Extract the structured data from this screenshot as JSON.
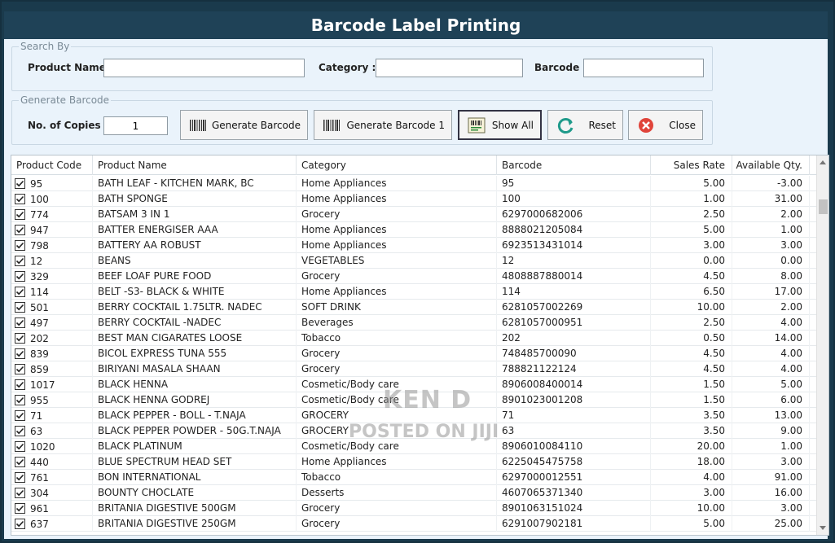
{
  "window": {
    "title": "Barcode Label Printing"
  },
  "search": {
    "legend": "Search By",
    "product_name_label": "Product Name :",
    "product_name_value": "",
    "category_label": "Category :",
    "category_value": "",
    "barcode_label": "Barcode :",
    "barcode_value": ""
  },
  "generate": {
    "legend": "Generate Barcode",
    "copies_label": "No. of Copies :",
    "copies_value": "1",
    "buttons": {
      "generate": "Generate Barcode",
      "generate1": "Generate Barcode 1",
      "show_all": "Show All",
      "reset": "Reset",
      "close": "Close"
    },
    "icons": {
      "generate": "barcode-icon",
      "generate1": "barcode-icon",
      "show_all": "barcode-list-icon",
      "reset": "refresh-icon",
      "close": "close-icon"
    }
  },
  "table": {
    "columns": [
      "Product Code",
      "Product Name",
      "Category",
      "Barcode",
      "Sales Rate",
      "Available Qty."
    ],
    "rows": [
      {
        "code": "95",
        "name": "BATH LEAF - KITCHEN MARK, BC",
        "category": "Home Appliances",
        "barcode": "95",
        "rate": "5.00",
        "qty": "-3.00"
      },
      {
        "code": "100",
        "name": "BATH SPONGE",
        "category": "Home Appliances",
        "barcode": "100",
        "rate": "1.00",
        "qty": "31.00"
      },
      {
        "code": "774",
        "name": "BATSAM 3 IN 1",
        "category": "Grocery",
        "barcode": "6297000682006",
        "rate": "2.50",
        "qty": "2.00"
      },
      {
        "code": "947",
        "name": "BATTER ENERGISER AAA",
        "category": "Home Appliances",
        "barcode": "8888021205084",
        "rate": "5.00",
        "qty": "1.00"
      },
      {
        "code": "798",
        "name": "BATTERY AA ROBUST",
        "category": "Home Appliances",
        "barcode": "6923513431014",
        "rate": "3.00",
        "qty": "3.00"
      },
      {
        "code": "12",
        "name": "BEANS",
        "category": "VEGETABLES",
        "barcode": "12",
        "rate": "0.00",
        "qty": "0.00"
      },
      {
        "code": "329",
        "name": "BEEF LOAF PURE FOOD",
        "category": "Grocery",
        "barcode": "4808887880014",
        "rate": "4.50",
        "qty": "8.00"
      },
      {
        "code": "114",
        "name": "BELT -S3- BLACK & WHITE",
        "category": "Home Appliances",
        "barcode": "114",
        "rate": "6.50",
        "qty": "17.00"
      },
      {
        "code": "501",
        "name": "BERRY COCKTAIL 1.75LTR. NADEC",
        "category": "SOFT DRINK",
        "barcode": "6281057002269",
        "rate": "10.00",
        "qty": "2.00"
      },
      {
        "code": "497",
        "name": "BERRY COCKTAIL -NADEC",
        "category": "Beverages",
        "barcode": "6281057000951",
        "rate": "2.50",
        "qty": "4.00"
      },
      {
        "code": "202",
        "name": "BEST MAN CIGARATES LOOSE",
        "category": "Tobacco",
        "barcode": "202",
        "rate": "0.50",
        "qty": "14.00"
      },
      {
        "code": "839",
        "name": "BICOL EXPRESS TUNA 555",
        "category": "Grocery",
        "barcode": "748485700090",
        "rate": "4.50",
        "qty": "4.00"
      },
      {
        "code": "859",
        "name": "BIRIYANI MASALA SHAAN",
        "category": "Grocery",
        "barcode": "788821122124",
        "rate": "4.50",
        "qty": "4.00"
      },
      {
        "code": "1017",
        "name": "BLACK HENNA",
        "category": "Cosmetic/Body care",
        "barcode": "8906008400014",
        "rate": "1.50",
        "qty": "5.00"
      },
      {
        "code": "955",
        "name": "BLACK HENNA GODREJ",
        "category": "Cosmetic/Body care",
        "barcode": "8901023001208",
        "rate": "1.50",
        "qty": "6.00"
      },
      {
        "code": "71",
        "name": "BLACK PEPPER - BOLL - T.NAJA",
        "category": "GROCERY",
        "barcode": "71",
        "rate": "3.50",
        "qty": "13.00"
      },
      {
        "code": "63",
        "name": "BLACK PEPPER POWDER - 50G.T.NAJA",
        "category": "GROCERY",
        "barcode": "63",
        "rate": "3.50",
        "qty": "9.00"
      },
      {
        "code": "1020",
        "name": "BLACK PLATINUM",
        "category": "Cosmetic/Body care",
        "barcode": "8906010084110",
        "rate": "20.00",
        "qty": "1.00"
      },
      {
        "code": "440",
        "name": "BLUE SPECTRUM HEAD SET",
        "category": "Home Appliances",
        "barcode": "6225045475758",
        "rate": "18.00",
        "qty": "3.00"
      },
      {
        "code": "761",
        "name": "BON INTERNATIONAL",
        "category": "Tobacco",
        "barcode": "6297000012551",
        "rate": "4.00",
        "qty": "91.00"
      },
      {
        "code": "304",
        "name": "BOUNTY CHOCLATE",
        "category": "Desserts",
        "barcode": "4607065371340",
        "rate": "3.00",
        "qty": "16.00"
      },
      {
        "code": "961",
        "name": "BRITANIA DIGESTIVE  500GM",
        "category": "Grocery",
        "barcode": "8901063151024",
        "rate": "10.00",
        "qty": "3.00"
      },
      {
        "code": "637",
        "name": "BRITANIA DIGESTIVE 250GM",
        "category": "Grocery",
        "barcode": "6291007902181",
        "rate": "5.00",
        "qty": "25.00"
      }
    ]
  },
  "watermark": {
    "line1": "KEN D",
    "line2": "POSTED ON JIJI"
  }
}
